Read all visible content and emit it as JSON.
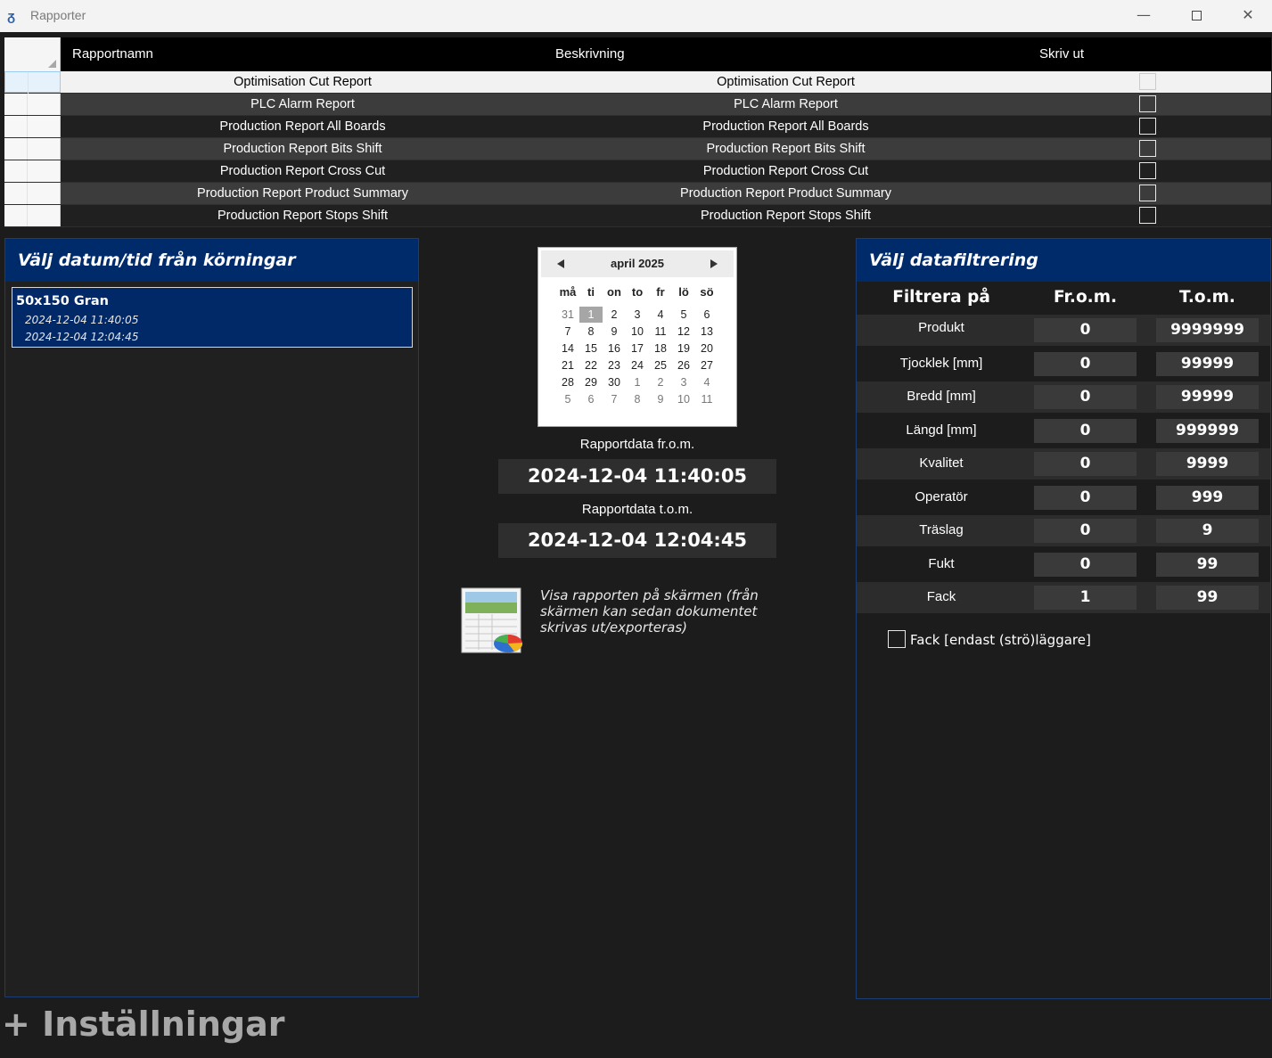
{
  "window": {
    "title": "Rapporter",
    "minimize": "—",
    "close": "✕"
  },
  "grid": {
    "headers": {
      "name": "Rapportnamn",
      "description": "Beskrivning",
      "print": "Skriv ut"
    },
    "rows": [
      {
        "name": "Optimisation Cut Report",
        "description": "Optimisation Cut Report"
      },
      {
        "name": "PLC Alarm Report",
        "description": "PLC Alarm Report"
      },
      {
        "name": "Production Report All Boards",
        "description": "Production Report All Boards"
      },
      {
        "name": "Production Report Bits Shift",
        "description": "Production Report Bits Shift"
      },
      {
        "name": "Production Report Cross Cut",
        "description": "Production Report Cross Cut"
      },
      {
        "name": "Production Report Product Summary",
        "description": "Production Report Product Summary"
      },
      {
        "name": "Production Report Stops Shift",
        "description": "Production Report Stops Shift"
      }
    ]
  },
  "runs": {
    "title": "Välj datum/tid från körningar",
    "items": [
      {
        "name": "50x150 Gran",
        "start": "2024-12-04 11:40:05",
        "end": "2024-12-04 12:04:45"
      }
    ]
  },
  "calendar": {
    "title": "april 2025",
    "weekdays": [
      "må",
      "ti",
      "on",
      "to",
      "fr",
      "lö",
      "sö"
    ],
    "weeks": [
      [
        "31",
        "1",
        "2",
        "3",
        "4",
        "5",
        "6"
      ],
      [
        "7",
        "8",
        "9",
        "10",
        "11",
        "12",
        "13"
      ],
      [
        "14",
        "15",
        "16",
        "17",
        "18",
        "19",
        "20"
      ],
      [
        "21",
        "22",
        "23",
        "24",
        "25",
        "26",
        "27"
      ],
      [
        "28",
        "29",
        "30",
        "1",
        "2",
        "3",
        "4"
      ],
      [
        "5",
        "6",
        "7",
        "8",
        "9",
        "10",
        "11"
      ]
    ],
    "selected": "1"
  },
  "report": {
    "from_label": "Rapportdata fr.o.m.",
    "from_value": "2024-12-04 11:40:05",
    "to_label": "Rapportdata t.o.m.",
    "to_value": "2024-12-04 12:04:45",
    "show_text": "Visa rapporten på skärmen (från skärmen kan sedan dokumentet skrivas ut/exporteras)"
  },
  "filter": {
    "title": "Välj datafiltrering",
    "headers": {
      "field": "Filtrera på",
      "from": "Fr.o.m.",
      "to": "T.o.m."
    },
    "rows": [
      {
        "label": "Produkt",
        "from": "0",
        "to": "9999999"
      },
      {
        "label": "Tjocklek [mm]",
        "from": "0",
        "to": "99999"
      },
      {
        "label": "Bredd [mm]",
        "from": "0",
        "to": "99999"
      },
      {
        "label": "Längd [mm]",
        "from": "0",
        "to": "999999"
      },
      {
        "label": "Kvalitet",
        "from": "0",
        "to": "9999"
      },
      {
        "label": "Operatör",
        "from": "0",
        "to": "999"
      },
      {
        "label": "Träslag",
        "from": "0",
        "to": "9"
      },
      {
        "label": "Fukt",
        "from": "0",
        "to": "99"
      },
      {
        "label": "Fack",
        "from": "1",
        "to": "99"
      }
    ],
    "fack_option": "Fack [endast (strö)läggare]"
  },
  "settings": {
    "label": "+ Inställningar"
  },
  "colors": {
    "panel_header": "#002b6b",
    "background": "#1c1c1c",
    "selected_run": "#012867"
  }
}
